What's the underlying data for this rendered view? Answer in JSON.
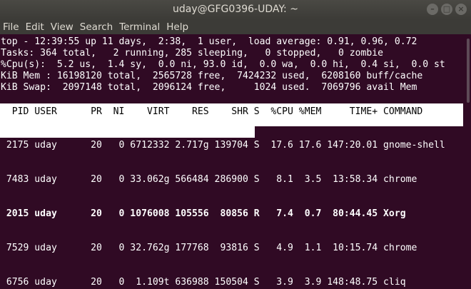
{
  "window": {
    "title": "uday@GFG0396-UDAY: ~"
  },
  "menu": [
    "File",
    "Edit",
    "View",
    "Search",
    "Terminal",
    "Help"
  ],
  "summary": {
    "line1": "top - 12:39:55 up 11 days,  2:38,  1 user,  load average: 0.91, 0.96, 0.72",
    "line2": "Tasks: 364 total,   2 running, 285 sleeping,   0 stopped,   0 zombie",
    "line3": "%Cpu(s):  5.2 us,  1.4 sy,  0.0 ni, 93.0 id,  0.0 wa,  0.0 hi,  0.4 si,  0.0 st",
    "line4": "KiB Mem : 16198120 total,  2565728 free,  7424232 used,  6208160 buff/cache",
    "line5": "KiB Swap:  2097148 total,  2096124 free,     1024 used.  7069796 avail Mem"
  },
  "table": {
    "header": "  PID USER      PR  NI    VIRT    RES    SHR S  %CPU %MEM     TIME+ COMMAND",
    "rows": [
      {
        "line": " 2175 uday      20   0 6712332 2.717g 139704 S  17.6 17.6 147:20.01 gnome-shell",
        "bold": false
      },
      {
        "line": " 7483 uday      20   0 33.062g 566484 286900 S   8.1  3.5  13:58.34 chrome",
        "bold": false
      },
      {
        "line": " 2015 uday      20   0 1076008 105556  80856 R   7.4  0.7  80:44.45 Xorg",
        "bold": true
      },
      {
        "line": " 7529 uday      20   0 32.762g 177768  93816 S   4.9  1.1  10:15.74 chrome",
        "bold": false
      },
      {
        "line": " 6756 uday      20   0  1.109t 636988 150504 S   3.9  3.9 148:48.75 cliq",
        "bold": false
      }
    ]
  },
  "colors": {
    "background": "#300a24",
    "titlebar": "#3c3b37"
  }
}
